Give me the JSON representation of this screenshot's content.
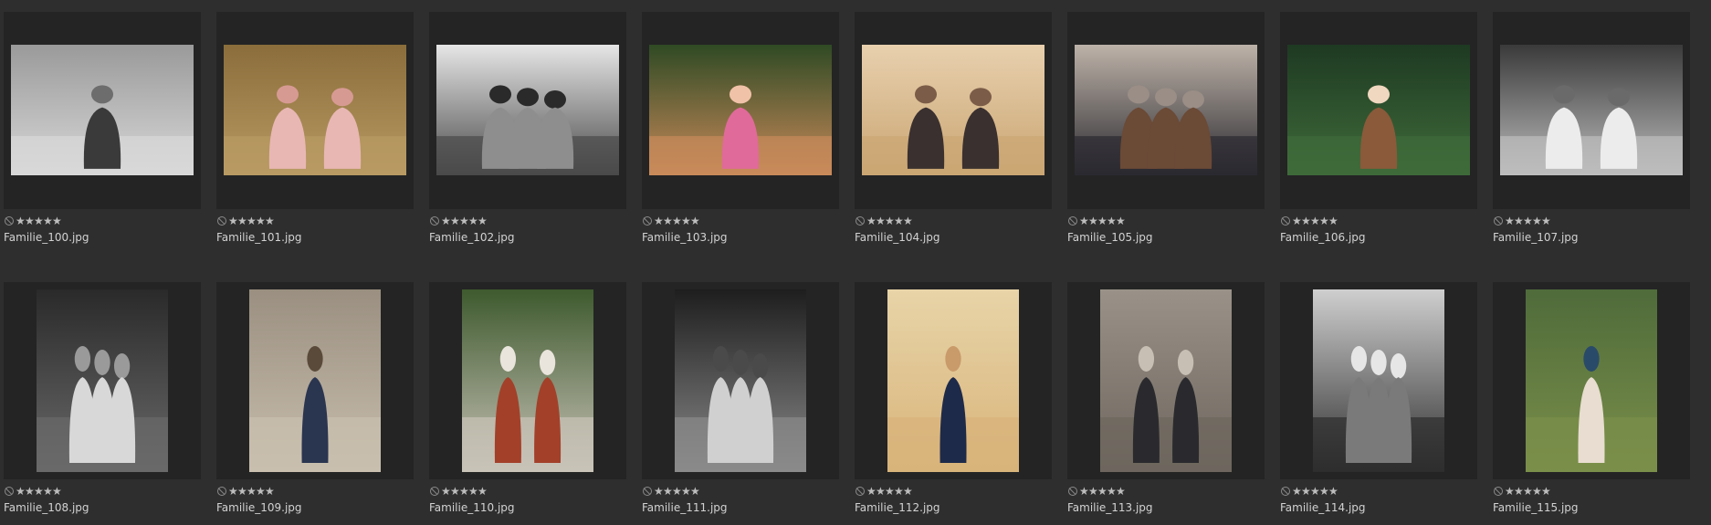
{
  "thumbnails": [
    {
      "filename": "Familie_100.jpg",
      "rating_icon": "reject-icon",
      "stars": 5,
      "orientation": "landscape",
      "tone": "bw",
      "palette": [
        "#9a9a9a",
        "#d8d8d8",
        "#3a3a3a",
        "#6d6d6d"
      ]
    },
    {
      "filename": "Familie_101.jpg",
      "rating_icon": "reject-icon",
      "stars": 5,
      "orientation": "landscape",
      "tone": "color",
      "palette": [
        "#8a6d3b",
        "#b89a62",
        "#e8b7b4",
        "#d79a93"
      ]
    },
    {
      "filename": "Familie_102.jpg",
      "rating_icon": "reject-icon",
      "stars": 5,
      "orientation": "landscape",
      "tone": "bw",
      "palette": [
        "#e6e6e6",
        "#4a4a4a",
        "#8e8e8e",
        "#2a2a2a"
      ]
    },
    {
      "filename": "Familie_103.jpg",
      "rating_icon": "reject-icon",
      "stars": 5,
      "orientation": "landscape",
      "tone": "color",
      "palette": [
        "#2f4a24",
        "#c98a5a",
        "#e06a9a",
        "#f0c2a8"
      ]
    },
    {
      "filename": "Familie_104.jpg",
      "rating_icon": "reject-icon",
      "stars": 5,
      "orientation": "landscape",
      "tone": "color",
      "palette": [
        "#e8d0ae",
        "#caa673",
        "#3a3030",
        "#7a5c48"
      ]
    },
    {
      "filename": "Familie_105.jpg",
      "rating_icon": "reject-icon",
      "stars": 5,
      "orientation": "landscape",
      "tone": "color",
      "palette": [
        "#bdb2a8",
        "#2b2a30",
        "#6b4a36",
        "#9a8e86"
      ]
    },
    {
      "filename": "Familie_106.jpg",
      "rating_icon": "reject-icon",
      "stars": 5,
      "orientation": "landscape",
      "tone": "color",
      "palette": [
        "#1e3a22",
        "#3f6b3a",
        "#8a5a3a",
        "#f0d7c0"
      ]
    },
    {
      "filename": "Familie_107.jpg",
      "rating_icon": "reject-icon",
      "stars": 5,
      "orientation": "landscape",
      "tone": "bw",
      "palette": [
        "#3a3a3a",
        "#bdbdbd",
        "#ececec",
        "#6a6a6a"
      ]
    },
    {
      "filename": "Familie_108.jpg",
      "rating_icon": "reject-icon",
      "stars": 5,
      "orientation": "portrait",
      "tone": "bw",
      "palette": [
        "#2a2a2a",
        "#6a6a6a",
        "#d8d8d8",
        "#9a9a9a"
      ]
    },
    {
      "filename": "Familie_109.jpg",
      "rating_icon": "reject-icon",
      "stars": 5,
      "orientation": "portrait",
      "tone": "color",
      "palette": [
        "#9a8f80",
        "#c9bfae",
        "#2a3550",
        "#5a4a3a"
      ]
    },
    {
      "filename": "Familie_110.jpg",
      "rating_icon": "reject-icon",
      "stars": 5,
      "orientation": "portrait",
      "tone": "color",
      "palette": [
        "#3e5a2e",
        "#c9c3b8",
        "#a3402a",
        "#e9e4dc"
      ]
    },
    {
      "filename": "Familie_111.jpg",
      "rating_icon": "reject-icon",
      "stars": 5,
      "orientation": "portrait",
      "tone": "bw",
      "palette": [
        "#1e1e1e",
        "#8a8a8a",
        "#d0d0d0",
        "#4a4a4a"
      ]
    },
    {
      "filename": "Familie_112.jpg",
      "rating_icon": "reject-icon",
      "stars": 5,
      "orientation": "portrait",
      "tone": "color",
      "palette": [
        "#e8d4a8",
        "#d8b47a",
        "#1e2a4a",
        "#c99a6a"
      ]
    },
    {
      "filename": "Familie_113.jpg",
      "rating_icon": "reject-icon",
      "stars": 5,
      "orientation": "portrait",
      "tone": "color",
      "palette": [
        "#9a9288",
        "#6e665e",
        "#2a2a2e",
        "#c8bfb4"
      ]
    },
    {
      "filename": "Familie_114.jpg",
      "rating_icon": "reject-icon",
      "stars": 5,
      "orientation": "portrait",
      "tone": "bw",
      "palette": [
        "#cfcfcf",
        "#2e2e2e",
        "#7a7a7a",
        "#e6e6e6"
      ]
    },
    {
      "filename": "Familie_115.jpg",
      "rating_icon": "reject-icon",
      "stars": 5,
      "orientation": "portrait",
      "tone": "color",
      "palette": [
        "#4f6b3a",
        "#7a8f4a",
        "#e8ddd0",
        "#2a4a6a"
      ]
    }
  ]
}
